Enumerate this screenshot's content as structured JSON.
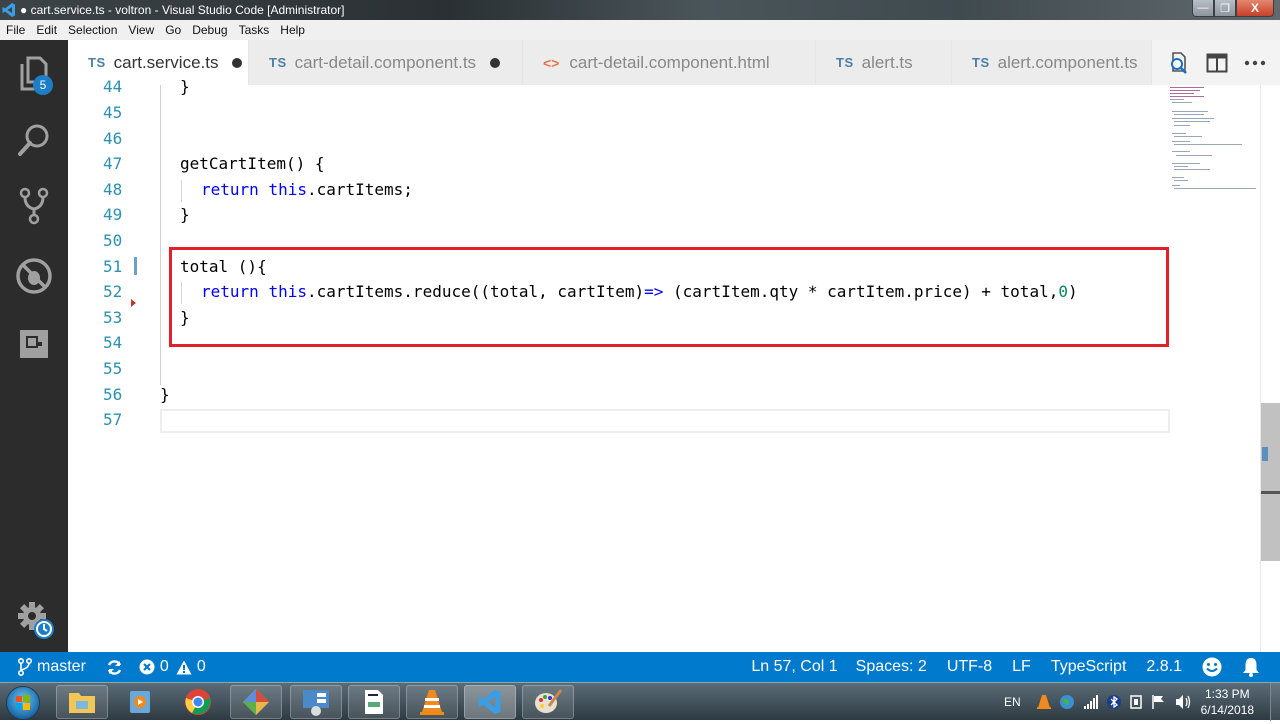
{
  "window": {
    "title": "● cart.service.ts - voltron - Visual Studio Code [Administrator]",
    "controls": {
      "minimize": "—",
      "restore": "❐",
      "close": "X"
    }
  },
  "menu": [
    "File",
    "Edit",
    "Selection",
    "View",
    "Go",
    "Debug",
    "Tasks",
    "Help"
  ],
  "activity_bar": {
    "explorer_badge": "5",
    "items": [
      "explorer-icon",
      "search-icon",
      "source-control-icon",
      "debug-icon",
      "extensions-icon"
    ],
    "bottom": "settings-icon"
  },
  "tabs": [
    {
      "icon": "TS",
      "label": "cart.service.ts",
      "dirty": true,
      "active": true
    },
    {
      "icon": "TS",
      "label": "cart-detail.component.ts",
      "dirty": true,
      "active": false
    },
    {
      "icon": "<>",
      "label": "cart-detail.component.html",
      "dirty": false,
      "active": false
    },
    {
      "icon": "TS",
      "label": "alert.ts",
      "dirty": false,
      "active": false
    },
    {
      "icon": "TS",
      "label": "alert.component.ts",
      "dirty": false,
      "active": false
    }
  ],
  "tab_actions": [
    "open-preview-icon",
    "split-editor-icon",
    "more-actions-icon"
  ],
  "editor": {
    "lines": [
      {
        "n": "44",
        "text": "  }"
      },
      {
        "n": "45",
        "text": ""
      },
      {
        "n": "46",
        "text": ""
      },
      {
        "n": "47",
        "text": "  getCartItem() {"
      },
      {
        "n": "48",
        "text": "    return this.cartItems;"
      },
      {
        "n": "49",
        "text": "  }"
      },
      {
        "n": "50",
        "text": ""
      },
      {
        "n": "51",
        "text": "  total (){"
      },
      {
        "n": "52",
        "text": "    return this.cartItems.reduce((total, cartItem)=> (cartItem.qty * cartItem.price) + total,0)"
      },
      {
        "n": "53",
        "text": "  }"
      },
      {
        "n": "54",
        "text": ""
      },
      {
        "n": "55",
        "text": ""
      },
      {
        "n": "56",
        "text": "}"
      },
      {
        "n": "57",
        "text": ""
      }
    ],
    "tokens": {
      "l44": "}",
      "l47": "getCartItem() {",
      "l48_kw1": "return",
      "l48_kw2": "this",
      "l48_rest": ".cartItems;",
      "l49": "}",
      "l51": "total (){",
      "l52_kw1": "return",
      "l52_kw2": "this",
      "l52_mid": ".cartItems.reduce((total, cartItem)",
      "l52_arrow": "=>",
      "l52_rest": " (cartItem.qty * cartItem.price) + total,",
      "l52_num": "0",
      "l52_close": ")",
      "l53": "}",
      "l56": "}"
    },
    "highlight_color": "#e0202a"
  },
  "status_bar": {
    "branch": "master",
    "errors": "0",
    "warnings": "0",
    "position": "Ln 57, Col 1",
    "indent": "Spaces: 2",
    "encoding": "UTF-8",
    "eol": "LF",
    "language": "TypeScript",
    "version": "2.8.1",
    "color": "#007acc"
  },
  "taskbar": {
    "apps": [
      "file-explorer",
      "media-player",
      "chrome",
      "git-gui",
      "control-panel",
      "document-viewer",
      "vlc",
      "vscode",
      "paint"
    ],
    "tray": {
      "language": "EN",
      "time": "1:33 PM",
      "date": "6/14/2018"
    }
  }
}
